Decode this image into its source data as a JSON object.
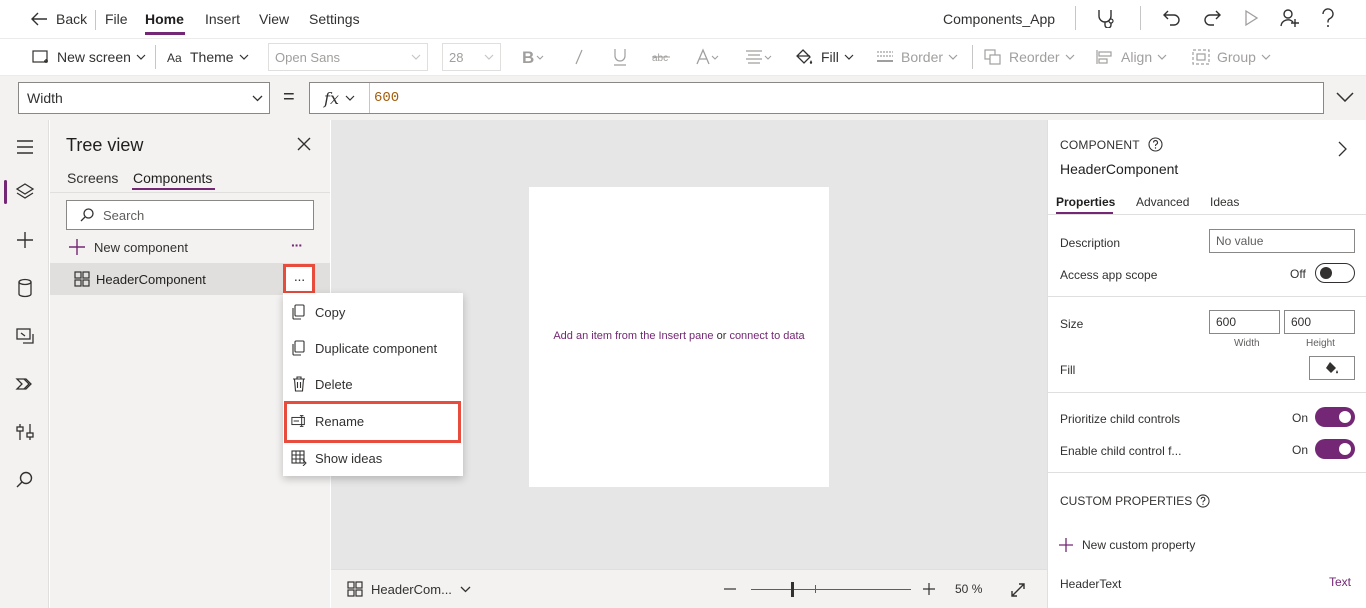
{
  "menubar": {
    "back_label": "Back",
    "menus": [
      "File",
      "Home",
      "Insert",
      "View",
      "Settings"
    ],
    "app_name": "Components_App"
  },
  "toolbar": {
    "new_screen_label": "New screen",
    "theme_label": "Theme",
    "font_value": "Open Sans",
    "font_size_value": "28",
    "fill_label": "Fill",
    "border_label": "Border",
    "reorder_label": "Reorder",
    "align_label": "Align",
    "group_label": "Group"
  },
  "formula": {
    "property": "Width",
    "equals": "=",
    "fx": "fx",
    "value": "600"
  },
  "tree": {
    "title": "Tree view",
    "tabs": [
      "Screens",
      "Components"
    ],
    "active_tab": "Components",
    "search_placeholder": "Search",
    "new_component_label": "New component",
    "more_glyph": "···",
    "selected_item": "HeaderComponent"
  },
  "context_menu": {
    "items": [
      {
        "label": "Copy",
        "icon": "copy-icon"
      },
      {
        "label": "Duplicate component",
        "icon": "duplicate-icon"
      },
      {
        "label": "Delete",
        "icon": "trash-icon"
      },
      {
        "label": "Rename",
        "icon": "rename-icon"
      },
      {
        "label": "Show ideas",
        "icon": "ideas-icon"
      }
    ],
    "highlighted": "Rename"
  },
  "canvas": {
    "hint_prefix": "Add an item from the Insert pane",
    "hint_or": "or",
    "hint_link": "connect to data"
  },
  "statusbar": {
    "component_label": "HeaderCom...",
    "zoom_value": "50",
    "zoom_unit": "%",
    "zoom_percent": 50
  },
  "properties": {
    "type_label": "COMPONENT",
    "name": "HeaderComponent",
    "tabs": [
      "Properties",
      "Advanced",
      "Ideas"
    ],
    "active_tab": "Properties",
    "description_label": "Description",
    "description_placeholder": "No value",
    "access_scope_label": "Access app scope",
    "access_scope_state": "Off",
    "size_label": "Size",
    "width_value": "600",
    "height_value": "600",
    "width_caption": "Width",
    "height_caption": "Height",
    "fill_label": "Fill",
    "prioritize_label": "Prioritize child controls",
    "prioritize_state": "On",
    "enable_child_label": "Enable child control f...",
    "enable_child_state": "On",
    "custom_properties_label": "CUSTOM PROPERTIES",
    "new_custom_label": "New custom property",
    "custom_prop_name": "HeaderText",
    "custom_prop_type": "Text"
  },
  "colors": {
    "accent": "#742774",
    "highlight_border": "#e74c3c",
    "formula_value": "#a25c0b"
  }
}
